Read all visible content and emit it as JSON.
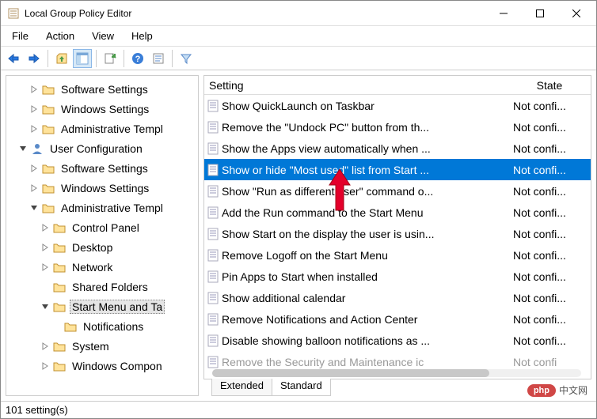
{
  "window": {
    "title": "Local Group Policy Editor"
  },
  "menu": {
    "items": [
      "File",
      "Action",
      "View",
      "Help"
    ]
  },
  "toolbar": {
    "back_icon": "back-arrow-icon",
    "forward_icon": "forward-arrow-icon",
    "up_icon": "up-level-icon",
    "show_tree_icon": "show-tree-icon",
    "export_icon": "export-list-icon",
    "help_icon": "help-icon",
    "properties_icon": "properties-icon",
    "filter_icon": "filter-icon"
  },
  "tree": [
    {
      "label": "Software Settings",
      "level": 2,
      "toggle": ">",
      "icon": "folder"
    },
    {
      "label": "Windows Settings",
      "level": 2,
      "toggle": ">",
      "icon": "folder"
    },
    {
      "label": "Administrative Templ",
      "level": 2,
      "toggle": ">",
      "icon": "folder"
    },
    {
      "label": "User Configuration",
      "level": 1,
      "toggle": "v",
      "icon": "user"
    },
    {
      "label": "Software Settings",
      "level": 2,
      "toggle": ">",
      "icon": "folder"
    },
    {
      "label": "Windows Settings",
      "level": 2,
      "toggle": ">",
      "icon": "folder"
    },
    {
      "label": "Administrative Templ",
      "level": 2,
      "toggle": "v",
      "icon": "folder"
    },
    {
      "label": "Control Panel",
      "level": 3,
      "toggle": ">",
      "icon": "folder"
    },
    {
      "label": "Desktop",
      "level": 3,
      "toggle": ">",
      "icon": "folder"
    },
    {
      "label": "Network",
      "level": 3,
      "toggle": ">",
      "icon": "folder"
    },
    {
      "label": "Shared Folders",
      "level": 3,
      "toggle": "",
      "icon": "folder"
    },
    {
      "label": "Start Menu and Ta",
      "level": 3,
      "toggle": "v",
      "icon": "folder",
      "selected": true
    },
    {
      "label": "Notifications",
      "level": 4,
      "toggle": "",
      "icon": "folder"
    },
    {
      "label": "System",
      "level": 3,
      "toggle": ">",
      "icon": "folder"
    },
    {
      "label": "Windows Compon",
      "level": 3,
      "toggle": ">",
      "icon": "folder"
    }
  ],
  "list": {
    "headers": {
      "setting": "Setting",
      "state": "State"
    },
    "rows": [
      {
        "text": "Show QuickLaunch on Taskbar",
        "state": "Not confi..."
      },
      {
        "text": "Remove the \"Undock PC\" button from th...",
        "state": "Not confi..."
      },
      {
        "text": "Show the Apps view automatically when ...",
        "state": "Not confi..."
      },
      {
        "text": "Show or hide \"Most used\" list from Start ...",
        "state": "Not confi...",
        "selected": true
      },
      {
        "text": "Show \"Run as different user\" command o...",
        "state": "Not confi..."
      },
      {
        "text": "Add the Run command to the Start Menu",
        "state": "Not confi..."
      },
      {
        "text": "Show Start on the display the user is usin...",
        "state": "Not confi..."
      },
      {
        "text": "Remove Logoff on the Start Menu",
        "state": "Not confi..."
      },
      {
        "text": "Pin Apps to Start when installed",
        "state": "Not confi..."
      },
      {
        "text": "Show additional calendar",
        "state": "Not confi..."
      },
      {
        "text": "Remove Notifications and Action Center",
        "state": "Not confi..."
      },
      {
        "text": "Disable showing balloon notifications as ...",
        "state": "Not confi..."
      },
      {
        "text": "Remove the Security and Maintenance ic",
        "state": "Not confi ",
        "faded": true
      }
    ]
  },
  "tabs": {
    "extended": "Extended",
    "standard": "Standard"
  },
  "status": {
    "text": "101 setting(s)"
  },
  "watermark": {
    "badge": "php",
    "text": "中文网"
  }
}
